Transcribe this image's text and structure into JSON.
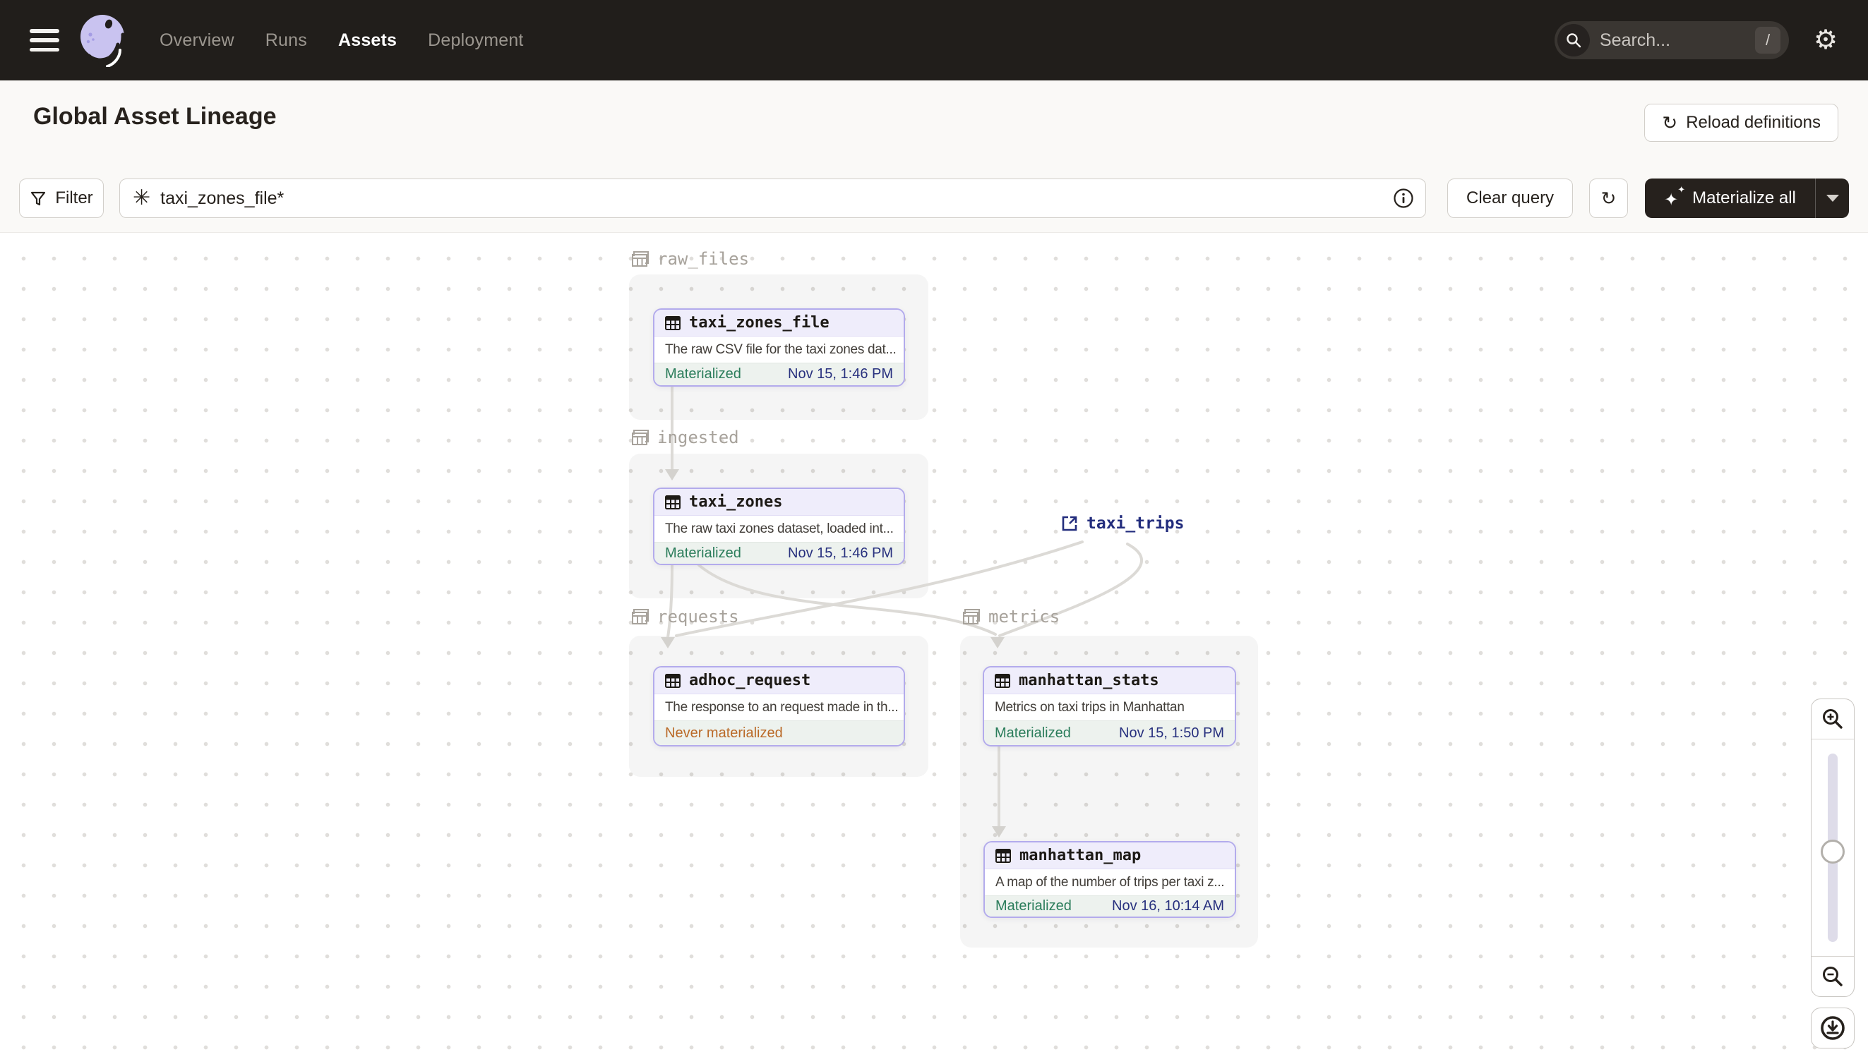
{
  "nav": {
    "tabs": [
      {
        "label": "Overview",
        "active": false
      },
      {
        "label": "Runs",
        "active": false
      },
      {
        "label": "Assets",
        "active": true
      },
      {
        "label": "Deployment",
        "active": false
      }
    ],
    "search_placeholder": "Search...",
    "search_shortcut": "/"
  },
  "header": {
    "title": "Global Asset Lineage",
    "reload_label": "Reload definitions"
  },
  "toolbar": {
    "filter_label": "Filter",
    "query_value": "taxi_zones_file*",
    "clear_label": "Clear query",
    "materialize_label": "Materialize all"
  },
  "graph": {
    "groups": [
      {
        "name": "raw_files"
      },
      {
        "name": "ingested"
      },
      {
        "name": "requests"
      },
      {
        "name": "metrics"
      }
    ],
    "nodes": [
      {
        "title": "taxi_zones_file",
        "description": "The raw CSV file for the taxi zones dat...",
        "status": "Materialized",
        "timestamp": "Nov 15, 1:46 PM"
      },
      {
        "title": "taxi_zones",
        "description": "The raw taxi zones dataset, loaded int...",
        "status": "Materialized",
        "timestamp": "Nov 15, 1:46 PM"
      },
      {
        "title": "adhoc_request",
        "description": "The response to an request made in th...",
        "status": "Never materialized",
        "timestamp": ""
      },
      {
        "title": "manhattan_stats",
        "description": "Metrics on taxi trips in Manhattan",
        "status": "Materialized",
        "timestamp": "Nov 15, 1:50 PM"
      },
      {
        "title": "manhattan_map",
        "description": "A map of the number of trips per taxi z...",
        "status": "Materialized",
        "timestamp": "Nov 16, 10:14 AM"
      }
    ],
    "external_assets": [
      {
        "label": "taxi_trips"
      }
    ]
  },
  "icons": {
    "hamburger": "three-bars",
    "logo": "dagster-swirl",
    "search": "magnifier",
    "gear": "⚙",
    "reload": "↻",
    "filter": "funnel",
    "asset-graph": "✳",
    "info": "circled-i",
    "materialize": "✦",
    "table": "grid-table",
    "group": "layered-tables",
    "external-link": "arrow-out-of-box",
    "zoom-in": "magnifier-plus",
    "zoom-out": "magnifier-minus",
    "download": "circled-down-arrow"
  },
  "colors": {
    "nav_bg": "#211E1B",
    "page_bg": "#FAF9F7",
    "node_border": "#B3ABEC",
    "node_header_bg": "#EFEDFB",
    "node_footer_bg": "#EDF2EE",
    "status_materialized": "#2B7D5B",
    "status_never": "#BA6A28",
    "timestamp": "#27307E",
    "external_asset": "#232D7D",
    "edge": "#DCDAD6",
    "group_label": "#A7A29B",
    "materialize_btn_bg": "#26211D"
  }
}
